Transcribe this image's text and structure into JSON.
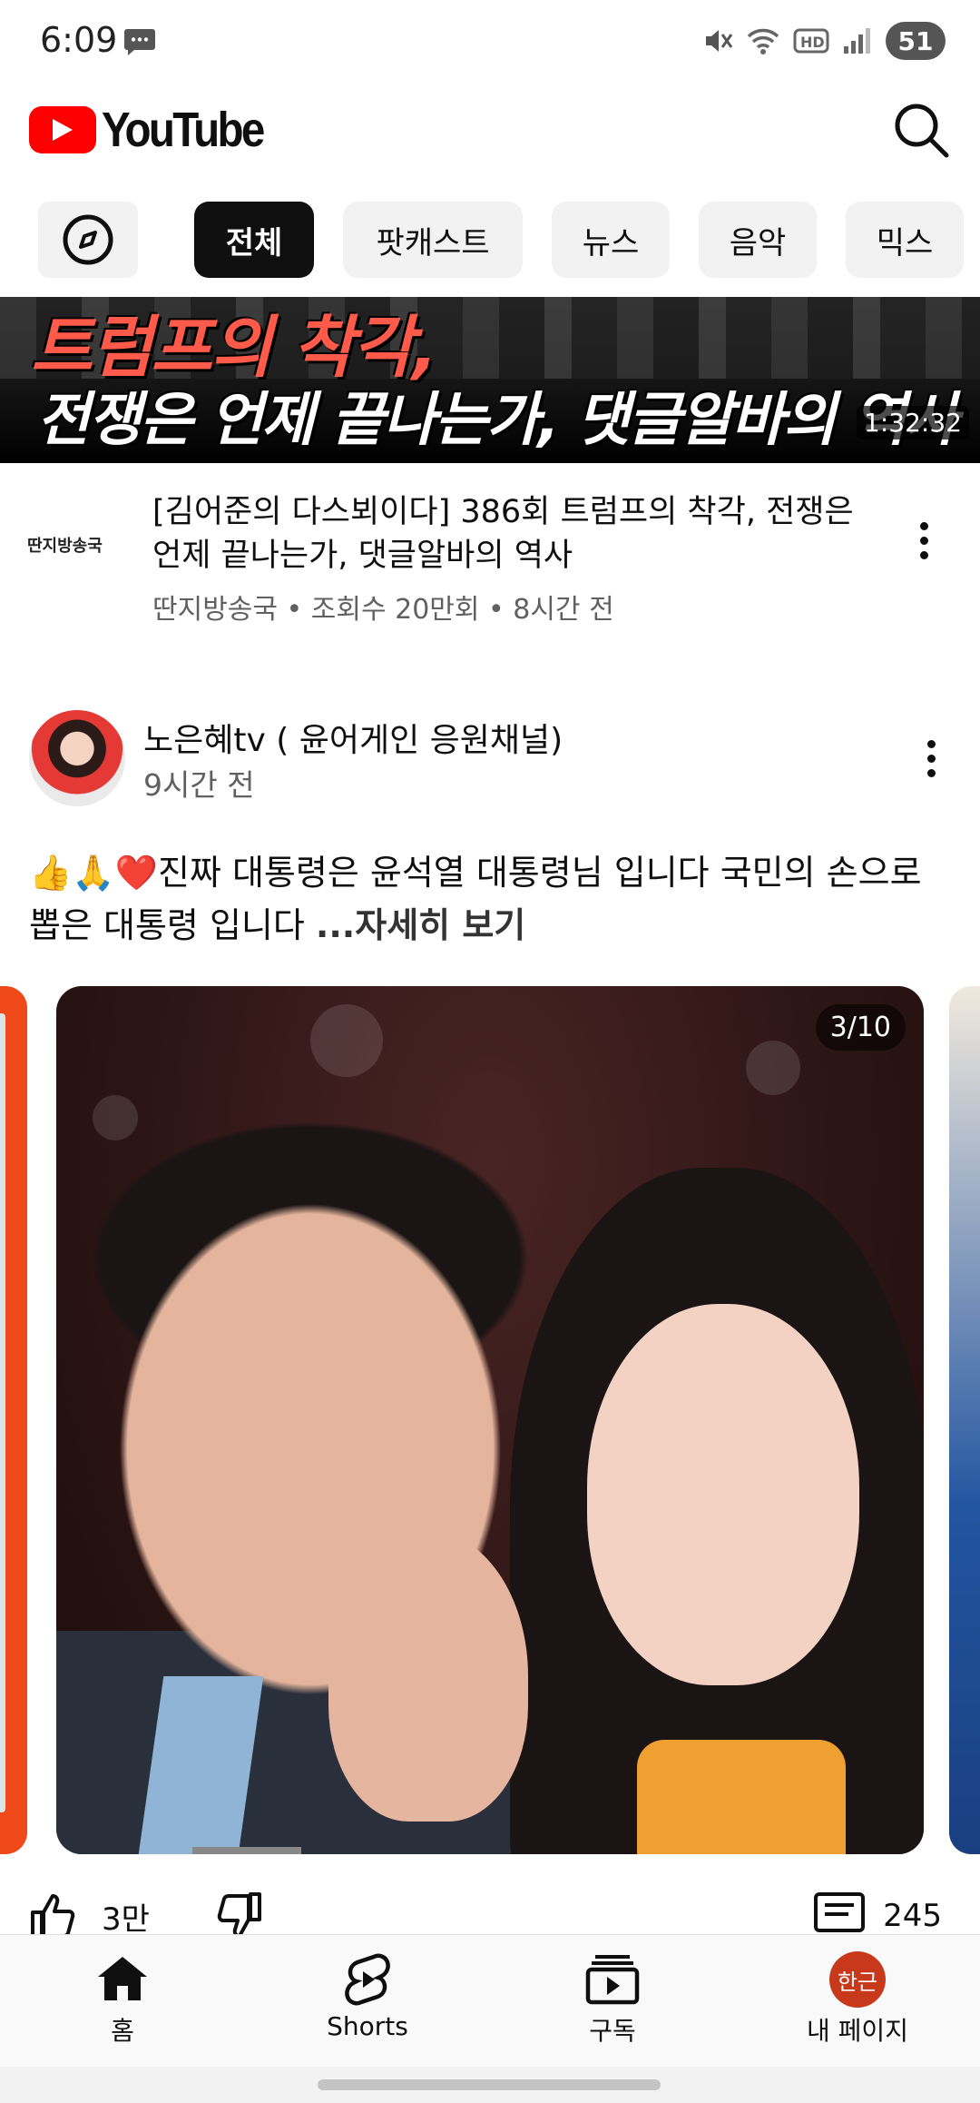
{
  "status_bar": {
    "time": "6:09",
    "battery": "51"
  },
  "header": {
    "brand": "YouTube"
  },
  "chips": [
    "전체",
    "팟캐스트",
    "뉴스",
    "음악",
    "믹스"
  ],
  "video": {
    "thumb_line1": "트럼프의 착각,",
    "thumb_line2": "전쟁은 언제 끝나는가, 댓글알바의 역사",
    "duration": "1:32:32",
    "channel_logo_text": "딴지방송국",
    "title": "[김어준의 다스뵈이다] 386회 트럼프의 착각, 전쟁은 언제 끝나는가, 댓글알바의 역사",
    "subtitle": "딴지방송국 • 조회수 20만회 • 8시간 전"
  },
  "post": {
    "channel": "노은혜tv ( 윤어게인 응원채널)",
    "time": "9시간 전",
    "text": "👍🙏❤️진짜 대통령은 윤석열 대통령님 입니다 국민의 손으로 뽑은 대통령 입니다 ",
    "more": "...자세히 보기",
    "counter": "3/10",
    "likes": "3만",
    "comments": "245"
  },
  "bottom_nav": {
    "home": "홈",
    "shorts": "Shorts",
    "subscriptions": "구독",
    "me": "내 페이지",
    "me_avatar": "한근"
  },
  "colors": {
    "brand_red": "#ff0000",
    "chip_active": "#0f0f0f",
    "chip_bg": "#f2f2f2",
    "avatar_me": "#c8391c"
  }
}
